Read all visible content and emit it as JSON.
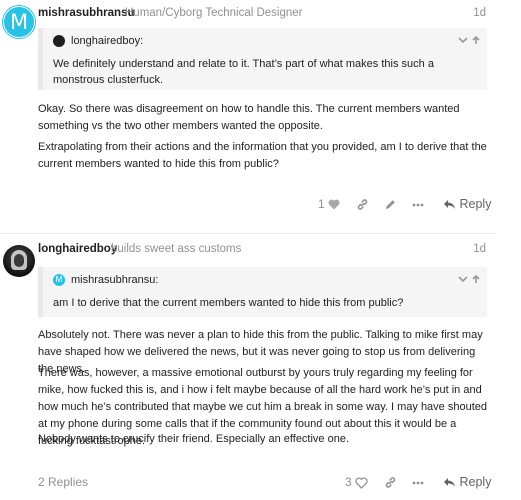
{
  "post1": {
    "avatar_letter": "M",
    "avatar_color": "#27c3e6",
    "username": "mishrasubhransu",
    "user_title": "Human/Cyborg Technical Designer",
    "age": "1d",
    "quote": {
      "author": "longhairedboy:",
      "text": "We definitely understand and relate to it. That’s part of what makes this such a monstrous clusterfuck."
    },
    "paragraphs": [
      "Okay. So there was disagreement on how to handle this. The current members wanted something vs the two other members wanted the opposite.",
      "Extrapolating from their actions and the information that you provided, am I to derive that the current members wanted to hide this from public?"
    ],
    "actions": {
      "like_count": "1",
      "like_icon": "heart-icon",
      "link_icon": "link-icon",
      "edit_icon": "pencil-icon",
      "more_icon": "ellipsis-icon",
      "reply_label": "Reply"
    }
  },
  "post2": {
    "username": "longhairedboy",
    "user_title": "builds sweet ass customs",
    "age": "1d",
    "quote": {
      "author_avatar_letter": "M",
      "author": "mishrasubhransu:",
      "text": "am I to derive that the current members wanted to hide this from public?"
    },
    "paragraphs": [
      "Absolutely not. There was never a plan to hide this from the public. Talking to mike first may have shaped how we delivered the news, but it was never going to stop us from delivering the news.",
      "There was, however, a massive emotional outburst by yours truly regarding my feeling for mike, how fucked this is, and i how i felt maybe because of all the hard work he’s put in and how much he’s contributed that maybe we cut him a break in some way. I may have shouted at my phone during some calls that if the community found out about this it would be a fucking fucktastrophe.",
      "Nobody wants to crucify their friend. Especially an effective one."
    ],
    "actions": {
      "replies_label": "2 Replies",
      "like_count": "3",
      "like_icon": "heart-outline-icon",
      "link_icon": "link-icon",
      "more_icon": "ellipsis-icon",
      "reply_label": "Reply"
    }
  }
}
